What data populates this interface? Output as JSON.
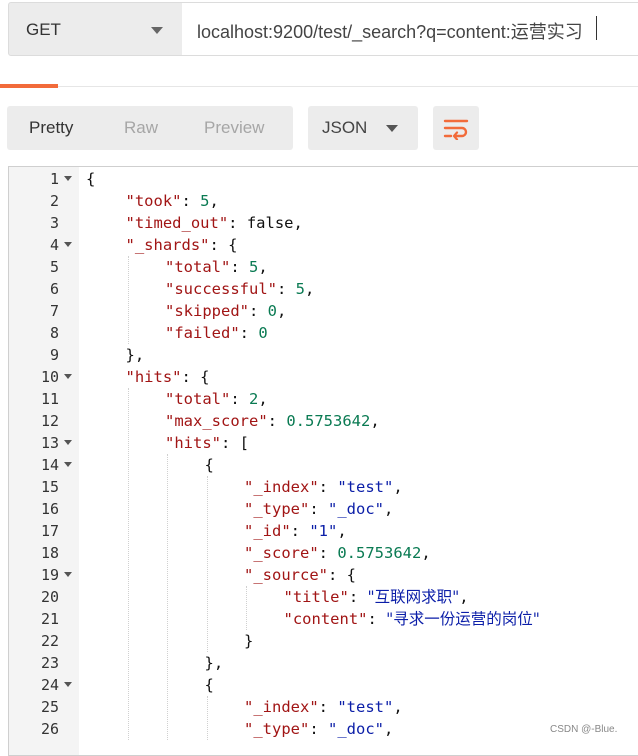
{
  "request": {
    "method": "GET",
    "url": "localhost:9200/test/_search?q=content:运营实习"
  },
  "response_toolbar": {
    "views": [
      "Pretty",
      "Raw",
      "Preview"
    ],
    "active_view": "Pretty",
    "format": "JSON",
    "wrap_icon": "wrap-lines-icon"
  },
  "colors": {
    "accent": "#f26b3a",
    "key": "#a11515",
    "string": "#0b1ea8",
    "number": "#097a52"
  },
  "code_lines": [
    {
      "n": "1",
      "fold": true,
      "tokens": [
        {
          "t": "p",
          "v": "{"
        }
      ]
    },
    {
      "n": "2",
      "tokens": [
        {
          "t": "k",
          "v": "\"took\""
        },
        {
          "t": "p",
          "v": ": "
        },
        {
          "t": "n",
          "v": "5"
        },
        {
          "t": "p",
          "v": ","
        }
      ]
    },
    {
      "n": "3",
      "tokens": [
        {
          "t": "k",
          "v": "\"timed_out\""
        },
        {
          "t": "p",
          "v": ": "
        },
        {
          "t": "b",
          "v": "false"
        },
        {
          "t": "p",
          "v": ","
        }
      ]
    },
    {
      "n": "4",
      "fold": true,
      "tokens": [
        {
          "t": "k",
          "v": "\"_shards\""
        },
        {
          "t": "p",
          "v": ": {"
        }
      ]
    },
    {
      "n": "5",
      "tokens": [
        {
          "t": "k",
          "v": "\"total\""
        },
        {
          "t": "p",
          "v": ": "
        },
        {
          "t": "n",
          "v": "5"
        },
        {
          "t": "p",
          "v": ","
        }
      ]
    },
    {
      "n": "6",
      "tokens": [
        {
          "t": "k",
          "v": "\"successful\""
        },
        {
          "t": "p",
          "v": ": "
        },
        {
          "t": "n",
          "v": "5"
        },
        {
          "t": "p",
          "v": ","
        }
      ]
    },
    {
      "n": "7",
      "tokens": [
        {
          "t": "k",
          "v": "\"skipped\""
        },
        {
          "t": "p",
          "v": ": "
        },
        {
          "t": "n",
          "v": "0"
        },
        {
          "t": "p",
          "v": ","
        }
      ]
    },
    {
      "n": "8",
      "tokens": [
        {
          "t": "k",
          "v": "\"failed\""
        },
        {
          "t": "p",
          "v": ": "
        },
        {
          "t": "n",
          "v": "0"
        }
      ]
    },
    {
      "n": "9",
      "tokens": [
        {
          "t": "p",
          "v": "},"
        }
      ]
    },
    {
      "n": "10",
      "fold": true,
      "tokens": [
        {
          "t": "k",
          "v": "\"hits\""
        },
        {
          "t": "p",
          "v": ": {"
        }
      ]
    },
    {
      "n": "11",
      "tokens": [
        {
          "t": "k",
          "v": "\"total\""
        },
        {
          "t": "p",
          "v": ": "
        },
        {
          "t": "n",
          "v": "2"
        },
        {
          "t": "p",
          "v": ","
        }
      ]
    },
    {
      "n": "12",
      "tokens": [
        {
          "t": "k",
          "v": "\"max_score\""
        },
        {
          "t": "p",
          "v": ": "
        },
        {
          "t": "n",
          "v": "0.5753642"
        },
        {
          "t": "p",
          "v": ","
        }
      ]
    },
    {
      "n": "13",
      "fold": true,
      "tokens": [
        {
          "t": "k",
          "v": "\"hits\""
        },
        {
          "t": "p",
          "v": ": ["
        }
      ]
    },
    {
      "n": "14",
      "fold": true,
      "tokens": [
        {
          "t": "p",
          "v": "{"
        }
      ]
    },
    {
      "n": "15",
      "tokens": [
        {
          "t": "k",
          "v": "\"_index\""
        },
        {
          "t": "p",
          "v": ": "
        },
        {
          "t": "s",
          "v": "\"test\""
        },
        {
          "t": "p",
          "v": ","
        }
      ]
    },
    {
      "n": "16",
      "tokens": [
        {
          "t": "k",
          "v": "\"_type\""
        },
        {
          "t": "p",
          "v": ": "
        },
        {
          "t": "s",
          "v": "\"_doc\""
        },
        {
          "t": "p",
          "v": ","
        }
      ]
    },
    {
      "n": "17",
      "tokens": [
        {
          "t": "k",
          "v": "\"_id\""
        },
        {
          "t": "p",
          "v": ": "
        },
        {
          "t": "s",
          "v": "\"1\""
        },
        {
          "t": "p",
          "v": ","
        }
      ]
    },
    {
      "n": "18",
      "tokens": [
        {
          "t": "k",
          "v": "\"_score\""
        },
        {
          "t": "p",
          "v": ": "
        },
        {
          "t": "n",
          "v": "0.5753642"
        },
        {
          "t": "p",
          "v": ","
        }
      ]
    },
    {
      "n": "19",
      "fold": true,
      "tokens": [
        {
          "t": "k",
          "v": "\"_source\""
        },
        {
          "t": "p",
          "v": ": {"
        }
      ]
    },
    {
      "n": "20",
      "tokens": [
        {
          "t": "k",
          "v": "\"title\""
        },
        {
          "t": "p",
          "v": ": "
        },
        {
          "t": "s",
          "v": "\"互联网求职\""
        },
        {
          "t": "p",
          "v": ","
        }
      ]
    },
    {
      "n": "21",
      "tokens": [
        {
          "t": "k",
          "v": "\"content\""
        },
        {
          "t": "p",
          "v": ": "
        },
        {
          "t": "s",
          "v": "\"寻求一份运营的岗位\""
        }
      ]
    },
    {
      "n": "22",
      "tokens": [
        {
          "t": "p",
          "v": "}"
        }
      ]
    },
    {
      "n": "23",
      "tokens": [
        {
          "t": "p",
          "v": "},"
        }
      ]
    },
    {
      "n": "24",
      "fold": true,
      "tokens": [
        {
          "t": "p",
          "v": "{"
        }
      ]
    },
    {
      "n": "25",
      "tokens": [
        {
          "t": "k",
          "v": "\"_index\""
        },
        {
          "t": "p",
          "v": ": "
        },
        {
          "t": "s",
          "v": "\"test\""
        },
        {
          "t": "p",
          "v": ","
        }
      ]
    },
    {
      "n": "26",
      "tokens": [
        {
          "t": "k",
          "v": "\"_type\""
        },
        {
          "t": "p",
          "v": ": "
        },
        {
          "t": "s",
          "v": "\"_doc\""
        },
        {
          "t": "p",
          "v": ","
        }
      ]
    }
  ],
  "watermark": "CSDN @-Blue."
}
